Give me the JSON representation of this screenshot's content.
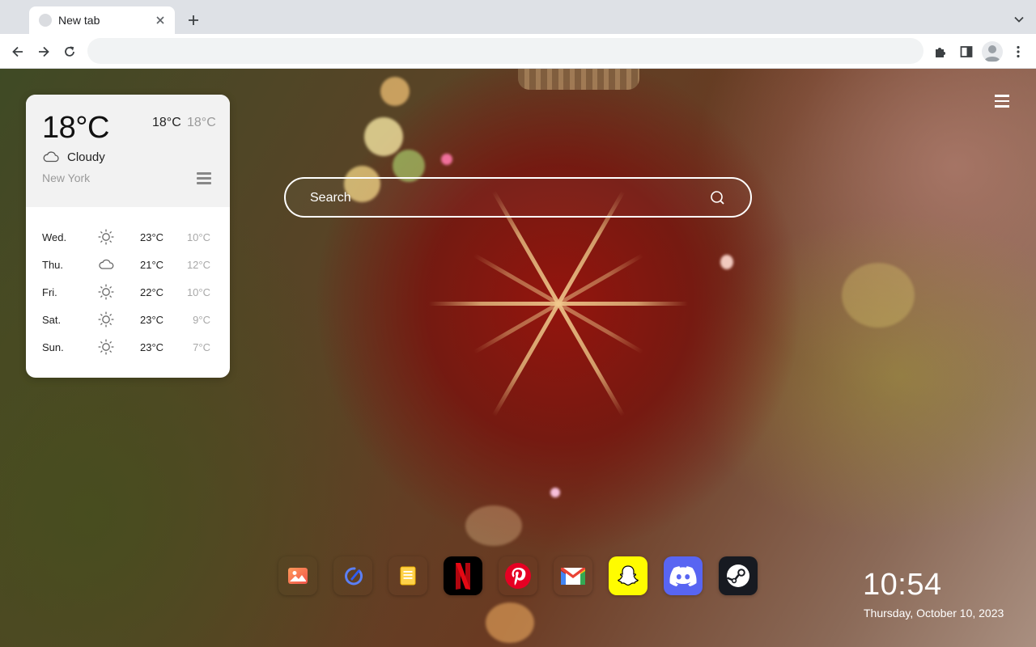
{
  "browser": {
    "tab": {
      "title": "New tab"
    },
    "omnibox": {
      "value": "",
      "placeholder": ""
    }
  },
  "weather": {
    "current_temp": "18°C",
    "high": "18°C",
    "low": "18°C",
    "condition": "Cloudy",
    "condition_icon": "cloud-icon",
    "city": "New York",
    "forecast": [
      {
        "day": "Wed.",
        "icon": "sun-icon",
        "high": "23°C",
        "low": "10°C"
      },
      {
        "day": "Thu.",
        "icon": "cloud-icon",
        "high": "21°C",
        "low": "12°C"
      },
      {
        "day": "Fri.",
        "icon": "sun-icon",
        "high": "22°C",
        "low": "10°C"
      },
      {
        "day": "Sat.",
        "icon": "sun-icon",
        "high": "23°C",
        "low": "9°C"
      },
      {
        "day": "Sun.",
        "icon": "sun-icon",
        "high": "23°C",
        "low": "7°C"
      }
    ]
  },
  "search": {
    "placeholder": "Search"
  },
  "dock": [
    {
      "name": "photos-app-icon",
      "bg": "#ffffff"
    },
    {
      "name": "drawing-app-icon",
      "bg": "#ffffff"
    },
    {
      "name": "notes-app-icon",
      "bg": "#ffffff"
    },
    {
      "name": "netflix-icon",
      "bg": "#000000"
    },
    {
      "name": "pinterest-icon",
      "bg": "#ffffff"
    },
    {
      "name": "gmail-icon",
      "bg": "#ffffff"
    },
    {
      "name": "snapchat-icon",
      "bg": "#fffc00"
    },
    {
      "name": "discord-icon",
      "bg": "#5865f2"
    },
    {
      "name": "steam-icon",
      "bg": "#171a21"
    }
  ],
  "clock": {
    "time": "10:54",
    "date": "Thursday, October 10, 2023"
  }
}
